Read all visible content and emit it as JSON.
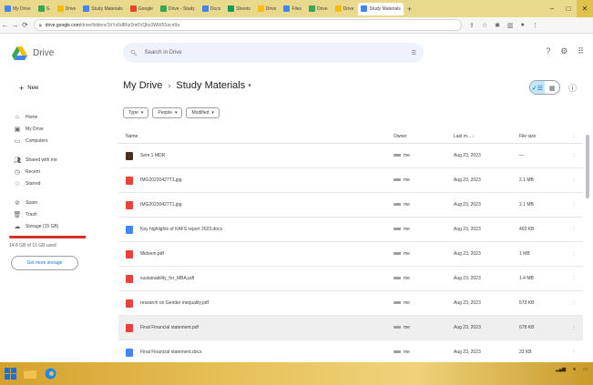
{
  "browser": {
    "tabs": [
      "My Drive",
      "G",
      "Drive",
      "Study Materials",
      "Google",
      "Drive - Study",
      "Docs",
      "Sheets",
      "Drive",
      "Files",
      "Drive",
      "Drive",
      "Study Materials"
    ],
    "url_host": "drive.google.com",
    "url_path": "/drive/folders/1hYz0d8Fp2m6VQkx3WtX5Sxcn9a"
  },
  "header": {
    "app_title": "Drive",
    "search_placeholder": "Search in Drive"
  },
  "sidebar": {
    "new_label": "New",
    "items": [
      {
        "icon": "home-icon",
        "label": "Home"
      },
      {
        "icon": "my-drive-icon",
        "label": "My Drive"
      },
      {
        "icon": "computers-icon",
        "label": "Computers"
      },
      {
        "icon": "shared-icon",
        "label": "Shared with me"
      },
      {
        "icon": "recent-icon",
        "label": "Recent"
      },
      {
        "icon": "starred-icon",
        "label": "Starred"
      },
      {
        "icon": "spam-icon",
        "label": "Spam"
      },
      {
        "icon": "trash-icon",
        "label": "Trash"
      },
      {
        "icon": "storage-icon",
        "label": "Storage (15 GB)"
      }
    ],
    "storage_used_fraction": 0.98,
    "storage_text": "14.8 GB of 15 GB used",
    "get_storage_label": "Get more storage"
  },
  "main": {
    "breadcrumb_root": "My Drive",
    "breadcrumb_current": "Study Materials",
    "filters": [
      "Type",
      "People",
      "Modified"
    ],
    "columns": {
      "name": "Name",
      "owner": "Owner",
      "modified": "Last m...",
      "size": "File size"
    },
    "rows": [
      {
        "type": "folder",
        "name": "Sem 1 MDR",
        "owner": "me",
        "modified": "Aug 23, 2023",
        "size": "—",
        "selected": false
      },
      {
        "type": "img",
        "name": "IMG20230427T1.jpg",
        "owner": "me",
        "modified": "Aug 23, 2023",
        "size": "2.1 MB",
        "selected": false
      },
      {
        "type": "img",
        "name": "IMG20230427T1.jpg",
        "owner": "me",
        "modified": "Aug 23, 2023",
        "size": "2.1 MB",
        "selected": false
      },
      {
        "type": "doc",
        "name": "Key highlights of KAFS report 2023.docx",
        "owner": "me",
        "modified": "Aug 23, 2023",
        "size": "403 KB",
        "selected": false
      },
      {
        "type": "pdf",
        "name": "Midsem.pdf",
        "owner": "me",
        "modified": "Aug 23, 2023",
        "size": "1 MB",
        "selected": false
      },
      {
        "type": "pdf",
        "name": "sustainability_for_MBA.pdf",
        "owner": "me",
        "modified": "Aug 23, 2023",
        "size": "1.4 MB",
        "selected": false
      },
      {
        "type": "pdf",
        "name": "research on Gender inequality.pdf",
        "owner": "me",
        "modified": "Aug 23, 2023",
        "size": "573 KB",
        "selected": false
      },
      {
        "type": "pdf",
        "name": "Final Financial statement.pdf",
        "owner": "me",
        "modified": "Aug 23, 2023",
        "size": "678 KB",
        "selected": true
      },
      {
        "type": "doc",
        "name": "Final Financial statement.docx",
        "owner": "me",
        "modified": "Aug 23, 2023",
        "size": "33 KB",
        "selected": false
      }
    ]
  },
  "colors": {
    "accent": "#1a73e8",
    "selected_toggle": "#c2e7ff",
    "pdf_red": "#ea4335",
    "doc_blue": "#4285f4",
    "taskbar": "#d4a12c"
  }
}
